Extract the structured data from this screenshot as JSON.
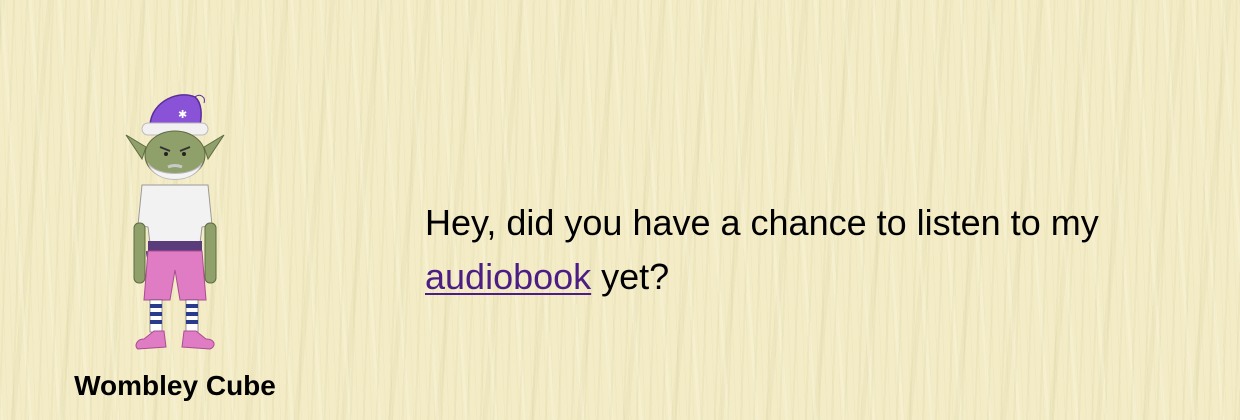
{
  "character": {
    "name": "Wombley Cube",
    "image_icon": "elf-character-icon"
  },
  "dialogue": {
    "text_before": "Hey, did you have a chance to listen to my ",
    "link_text": "audiobook",
    "text_after": " yet?"
  },
  "colors": {
    "background": "#f3ecc6",
    "link": "#4b1d85",
    "hat": "#8a52d6",
    "shorts": "#e07cc4",
    "skin": "#8fa06a"
  }
}
